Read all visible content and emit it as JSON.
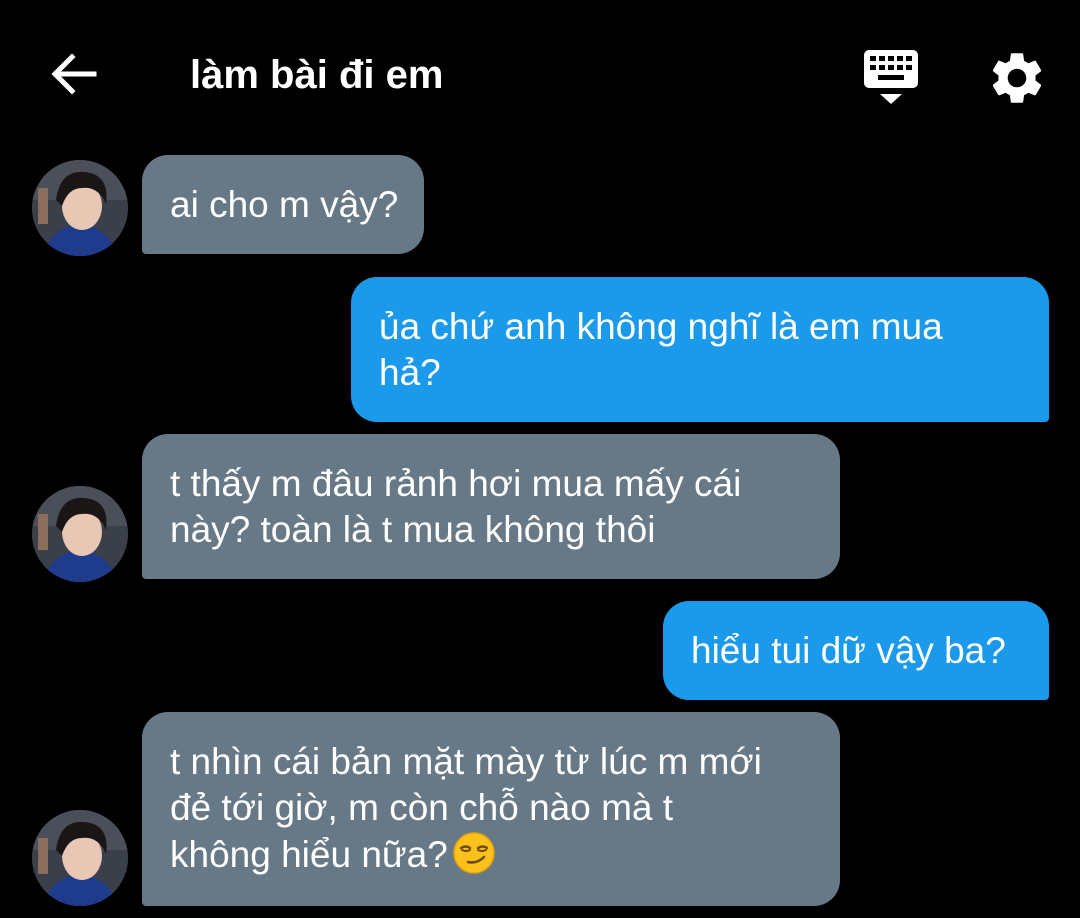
{
  "header": {
    "title": "làm bài đi em",
    "back_icon": "arrow-left-icon",
    "keyboard_icon": "keyboard-hide-icon",
    "settings_icon": "gear-icon"
  },
  "colors": {
    "background": "#000000",
    "received_bubble": "#677886",
    "sent_bubble": "#1b99ea",
    "text": "#ffffff"
  },
  "messages": [
    {
      "direction": "received",
      "text": "ai cho m vậy?"
    },
    {
      "direction": "sent",
      "line1": "ủa chứ anh không nghĩ là em mua",
      "line2": "hả?"
    },
    {
      "direction": "received",
      "line1": "t thấy m đâu rảnh hơi mua mấy cái",
      "line2": "này? toàn là t mua không thôi"
    },
    {
      "direction": "sent",
      "text": "hiểu tui dữ vậy ba?"
    },
    {
      "direction": "received",
      "line1": "t nhìn cái bản mặt mày từ lúc m mới",
      "line2": "đẻ tới giờ, m còn chỗ nào mà t",
      "line3": "không hiểu nữa?",
      "emoji": "smirking-face-emoji"
    }
  ]
}
